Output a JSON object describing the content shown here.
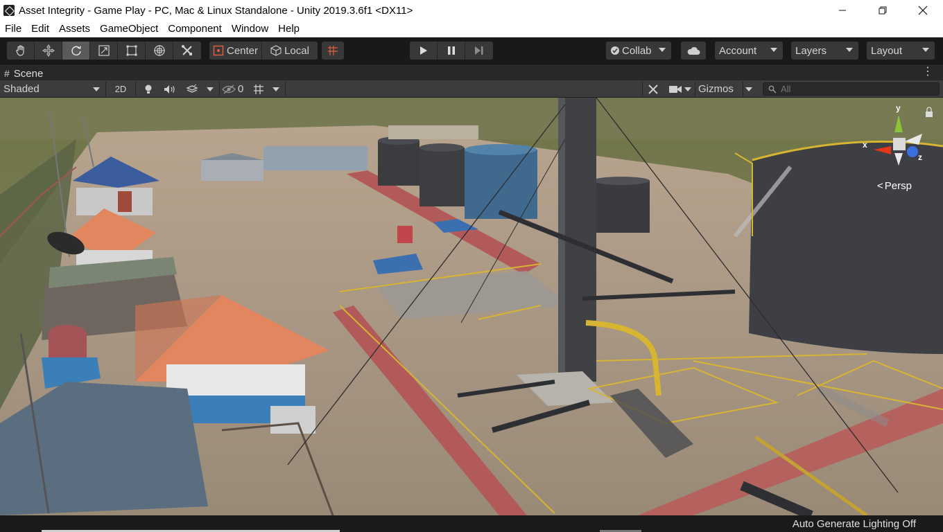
{
  "window": {
    "title": "Asset Integrity - Game Play - PC, Mac & Linux Standalone - Unity 2019.3.6f1 <DX11>",
    "controls": [
      "minimize-icon",
      "maximize-icon",
      "close-icon"
    ]
  },
  "menu": {
    "items": [
      "File",
      "Edit",
      "Assets",
      "GameObject",
      "Component",
      "Window",
      "Help"
    ]
  },
  "toolbar": {
    "tools": [
      "hand-tool-icon",
      "move-tool-icon",
      "rotate-tool-icon",
      "scale-tool-icon",
      "rect-tool-icon",
      "transform-tool-icon",
      "custom-tool-icon"
    ],
    "active_tool": "rotate-tool-icon",
    "pivot_label": "Center",
    "space_label": "Local",
    "snap_icon": "grid-snap-icon",
    "play_icons": [
      "play-icon",
      "pause-icon",
      "step-icon"
    ],
    "collab_label": "Collab",
    "cloud_icon": "cloud-icon",
    "account_label": "Account",
    "layers_label": "Layers",
    "layout_label": "Layout"
  },
  "scene": {
    "tab_label": "Scene",
    "draw_mode": "Shaded",
    "mode_2d": "2D",
    "hidden_count": "0",
    "gizmos_label": "Gizmos",
    "search_placeholder": "All",
    "projection_label": "Persp",
    "axes": {
      "x": "x",
      "y": "y",
      "z": "z"
    }
  },
  "status": {
    "text": "Auto Generate Lighting Off"
  },
  "colors": {
    "accent_active": "#5a5a5a",
    "toolbar_bg": "#191919",
    "panel_bg": "#3c3c3c",
    "ground": "#a3927f",
    "tank_dark": "#3d3f44",
    "tank_blue": "#3f6a8e",
    "roof_orange": "#e2865f",
    "walkway_red": "#b25a59",
    "railing_yellow": "#d7b431"
  }
}
